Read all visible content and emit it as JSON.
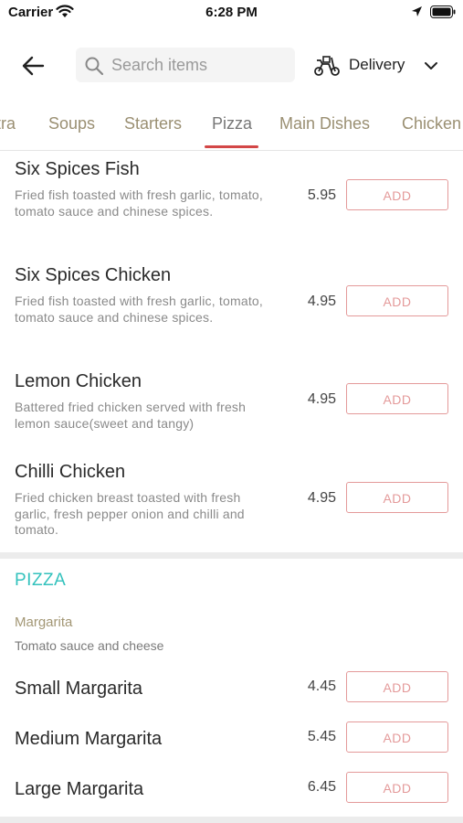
{
  "status_bar": {
    "carrier": "Carrier",
    "time": "6:28 PM"
  },
  "header": {
    "search_placeholder": "Search items",
    "delivery_label": "Delivery"
  },
  "tabs": [
    {
      "label": "tra"
    },
    {
      "label": "Soups"
    },
    {
      "label": "Starters"
    },
    {
      "label": "Pizza",
      "active": true
    },
    {
      "label": "Main Dishes"
    },
    {
      "label": "Chicken"
    }
  ],
  "items": [
    {
      "name": "Six Spices Fish",
      "description": "Fried fish toasted with fresh garlic, tomato, tomato sauce and chinese spices.",
      "price": "5.95",
      "add_label": "ADD"
    },
    {
      "name": "Six Spices Chicken",
      "description": "Fried fish toasted with fresh garlic, tomato, tomato sauce and chinese spices.",
      "price": "4.95",
      "add_label": "ADD"
    },
    {
      "name": "Lemon Chicken",
      "description": "Battered fried chicken served with fresh lemon sauce(sweet and tangy)",
      "price": "4.95",
      "add_label": "ADD"
    },
    {
      "name": "Chilli Chicken",
      "description": "Fried chicken breast toasted with fresh garlic, fresh pepper onion and chilli and tomato.",
      "price": "4.95",
      "add_label": "ADD"
    }
  ],
  "pizza_section": {
    "title": "PIZZA",
    "subcategory": "Margarita",
    "subcategory_description": "Tomato sauce and cheese",
    "items": [
      {
        "name": "Small Margarita",
        "price": "4.45",
        "add_label": "ADD"
      },
      {
        "name": "Medium Margarita",
        "price": "5.45",
        "add_label": "ADD"
      },
      {
        "name": "Large Margarita",
        "price": "6.45",
        "add_label": "ADD"
      }
    ]
  },
  "colors": {
    "accent_red": "#d34747",
    "add_border": "#e49a9a",
    "section_teal": "#33c2bd",
    "tab_text": "#9a8f72"
  }
}
